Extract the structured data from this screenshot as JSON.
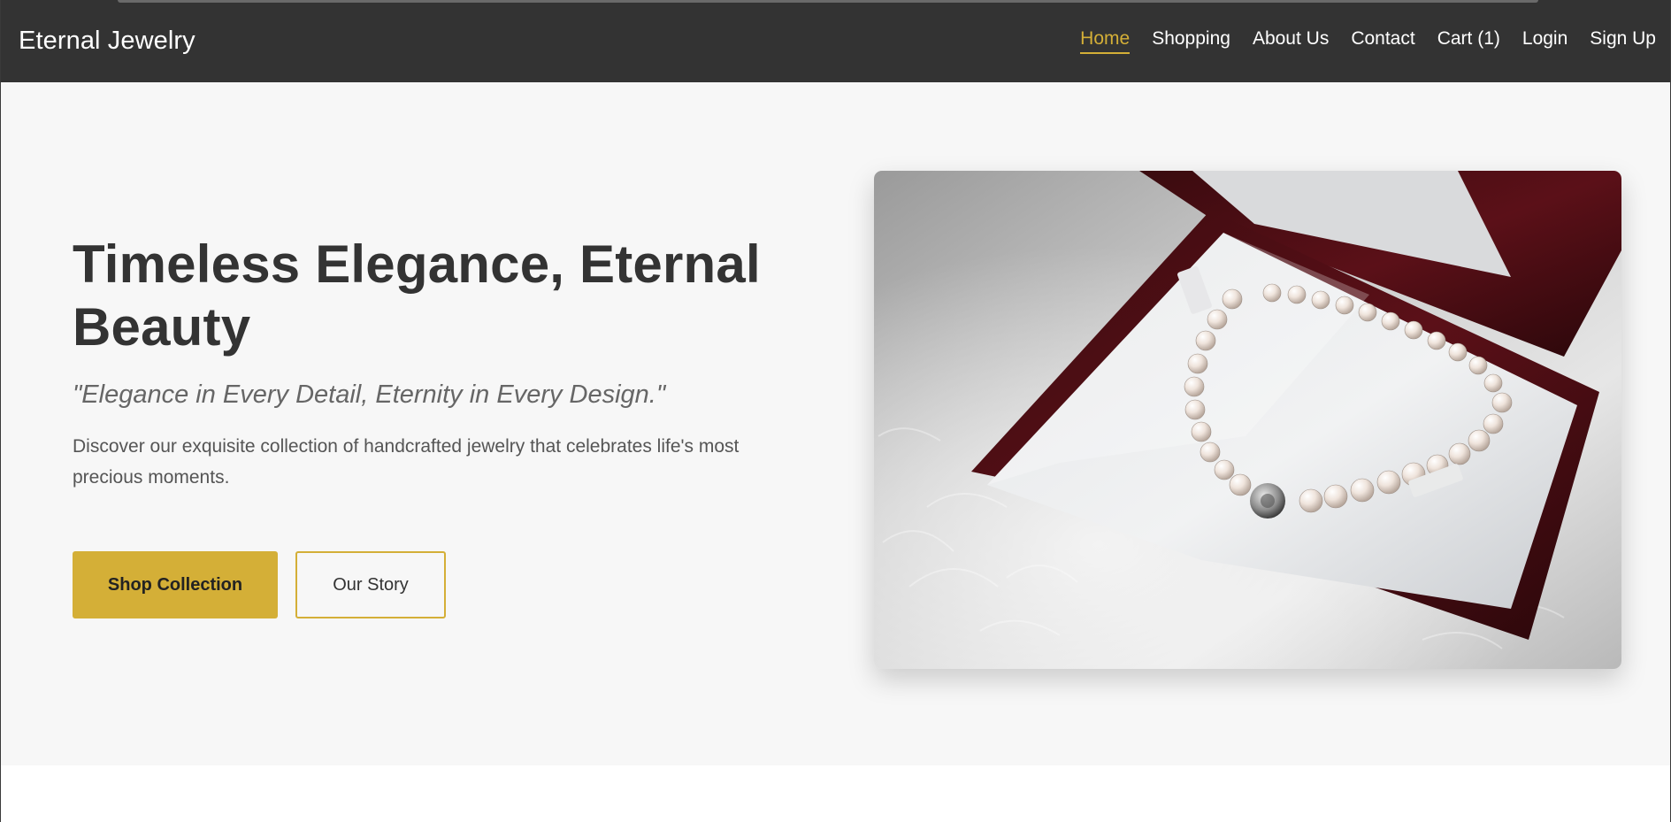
{
  "brand": {
    "name": "Eternal Jewelry"
  },
  "nav": {
    "items": [
      {
        "label": "Home",
        "active": true
      },
      {
        "label": "Shopping"
      },
      {
        "label": "About Us"
      },
      {
        "label": "Contact"
      },
      {
        "label": "Cart (1)"
      },
      {
        "label": "Login"
      },
      {
        "label": "Sign Up"
      }
    ]
  },
  "hero": {
    "title": "Timeless Elegance, Eternal Beauty",
    "tagline": "\"Elegance in Every Detail, Eternity in Every Design.\"",
    "description": "Discover our exquisite collection of handcrafted jewelry that celebrates life's most precious moments.",
    "primary_cta": "Shop Collection",
    "secondary_cta": "Our Story"
  },
  "colors": {
    "accent": "#d4af37",
    "navbar": "#333333",
    "hero_background": "#f7f7f7",
    "heading": "#333333"
  }
}
